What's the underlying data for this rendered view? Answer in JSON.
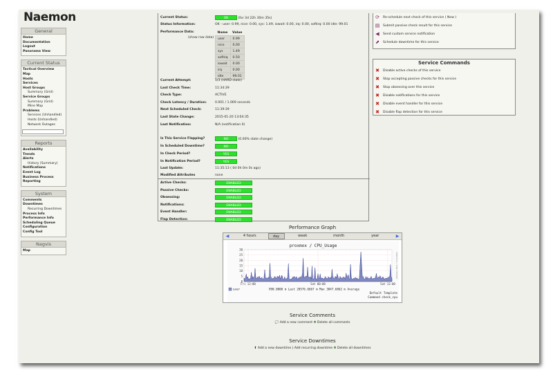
{
  "brand": "Naemon",
  "sidebar": {
    "general": {
      "title": "General",
      "items": [
        "Home",
        "Documentation",
        "Logout",
        "Panorama View"
      ]
    },
    "status": {
      "title": "Current Status",
      "items": [
        {
          "label": "Tactical Overview",
          "level": 0
        },
        {
          "label": "Map",
          "level": 0
        },
        {
          "label": "Hosts",
          "level": 0
        },
        {
          "label": "Services",
          "level": 0
        },
        {
          "label": "Host Groups",
          "level": 0
        },
        {
          "label": "Summary (Grid)",
          "level": 1
        },
        {
          "label": "Service Groups",
          "level": 0
        },
        {
          "label": "Summary (Grid)",
          "level": 1
        },
        {
          "label": "Mine Map",
          "level": 1
        },
        {
          "label": "Problems",
          "level": 0
        },
        {
          "label": "Services (Unhandled)",
          "level": 1
        },
        {
          "label": "Hosts (Unhandled)",
          "level": 1
        },
        {
          "label": "Network Outages",
          "level": 1
        }
      ]
    },
    "reports": {
      "title": "Reports",
      "items": [
        {
          "label": "Availability",
          "level": 0
        },
        {
          "label": "Trends",
          "level": 0
        },
        {
          "label": "Alerts",
          "level": 0
        },
        {
          "label": "History (Summary)",
          "level": 1
        },
        {
          "label": "Notifications",
          "level": 0
        },
        {
          "label": "Event Log",
          "level": 0
        },
        {
          "label": "Business Process",
          "level": 0
        },
        {
          "label": "Reporting",
          "level": 0
        }
      ]
    },
    "system": {
      "title": "System",
      "items": [
        {
          "label": "Comments",
          "level": 0
        },
        {
          "label": "Downtimes",
          "level": 0
        },
        {
          "label": "Recurring Downtimes",
          "level": 1
        },
        {
          "label": "Process Info",
          "level": 0
        },
        {
          "label": "Performance Info",
          "level": 0
        },
        {
          "label": "Scheduling Queue",
          "level": 0
        },
        {
          "label": "Configuration",
          "level": 0
        },
        {
          "label": "Config Tool",
          "level": 0
        }
      ]
    },
    "nagvis": {
      "title": "Nagvis",
      "items": [
        "Map"
      ]
    }
  },
  "service": {
    "current_status_label": "Current Status:",
    "current_status": "OK",
    "current_status_note": "(for 3d 22h 30m 35s)",
    "status_info_label": "Status Information:",
    "status_info": "OK - user: 0.99, nice: 0.00, sys: 1.49, iowait: 0.00, irq: 0.00, softirq: 0.00 idle: 99.01",
    "perf_label": "Performance Data:",
    "show_raw": "(show raw data)",
    "perf_headers": [
      "Name",
      "Value"
    ],
    "perf_rows": [
      [
        "user",
        "0.99"
      ],
      [
        "nice",
        "0.00"
      ],
      [
        "sys",
        "1.49"
      ],
      [
        "softirq",
        "0.50"
      ],
      [
        "iowait",
        "0.00"
      ],
      [
        "irq",
        "0.00"
      ],
      [
        "idle",
        "99.01"
      ]
    ],
    "fields": [
      {
        "label": "Current Attempt:",
        "value": "1/3  (HARD state)"
      },
      {
        "label": "Last Check Time:",
        "value": "11:34:39"
      },
      {
        "label": "Check Type:",
        "value": "ACTIVE"
      },
      {
        "label": "Check Latency / Duration:",
        "value": "0.001 / 1.069 seconds"
      },
      {
        "label": "Next Scheduled Check:",
        "value": "11:39:39"
      },
      {
        "label": "Last State Change:",
        "value": "2015-01-20 13:04:35"
      },
      {
        "label": "Last Notification:",
        "value": "N/A (notification 0)"
      }
    ],
    "flapping_label": "Is This Service Flapping?",
    "flapping": "NO",
    "flapping_note": "(0.00% state change)",
    "downtime_label": "In Scheduled Downtime?",
    "downtime": "NO",
    "check_period_label": "In Check Period?",
    "check_period": "YES",
    "notif_period_label": "In Notification Period?",
    "notif_period": "YES",
    "last_update_label": "Last Update:",
    "last_update": "11:35:13  ( 0d 0h 0m 0s ago)",
    "modified_label": "Modified Attributes",
    "modified": "none",
    "toggles": [
      {
        "label": "Active Checks:",
        "value": "ENABLED"
      },
      {
        "label": "Passive Checks:",
        "value": "ENABLED"
      },
      {
        "label": "Obsessing:",
        "value": "ENABLED"
      },
      {
        "label": "Notifications:",
        "value": "ENABLED"
      },
      {
        "label": "Event Handler:",
        "value": "ENABLED"
      },
      {
        "label": "Flap Detection:",
        "value": "ENABLED"
      }
    ]
  },
  "top_commands": [
    {
      "icon": "reschedule-icon",
      "label": "Re-schedule next check of this service ( Now )"
    },
    {
      "icon": "submit-icon",
      "label": "Submit passive check result for this service"
    },
    {
      "icon": "megaphone-icon",
      "label": "Send custom service notification"
    },
    {
      "icon": "downtime-icon",
      "label": "Schedule downtime for this service"
    }
  ],
  "service_commands": {
    "title": "Service Commands",
    "items": [
      "Disable active checks of this service",
      "Stop accepting passive checks for this service",
      "Stop obsessing over this service",
      "Disable notifications for this service",
      "Disable event handler for this service",
      "Disable flap detection for this service"
    ]
  },
  "performance_graph": {
    "title": "Performance Graph",
    "tabs": [
      "4 hours",
      "day",
      "week",
      "month",
      "year"
    ],
    "active_tab": "day",
    "chart_title": "proxmox / CPU_Usage",
    "y_ticks": [
      "30",
      "25",
      "20",
      "15",
      "10",
      "5",
      "0"
    ],
    "x_ticks": [
      "Fri 12:00",
      "Sat 00:00",
      "Sat 12:00"
    ],
    "legend_series": "user",
    "legend_stats": "990.0000 m Last   28576.6667 m Max   3847.6862 m Average",
    "legend_template": "Default Template",
    "legend_command": "Command check_cpu",
    "side_label": "RRDTOOL / TOBI OETIKER",
    "colors": {
      "series": "#1a2a8a",
      "grid": "#e0a0a0"
    }
  },
  "comments": {
    "title": "Service Comments",
    "add_label": "Add a new comment",
    "delete_label": "Delete all comments"
  },
  "downtimes": {
    "title": "Service Downtimes",
    "add_label": "Add a new downtime",
    "separator": "|",
    "recurring_label": "Add recurring downtime",
    "delete_label": "Delete all downtimes"
  }
}
